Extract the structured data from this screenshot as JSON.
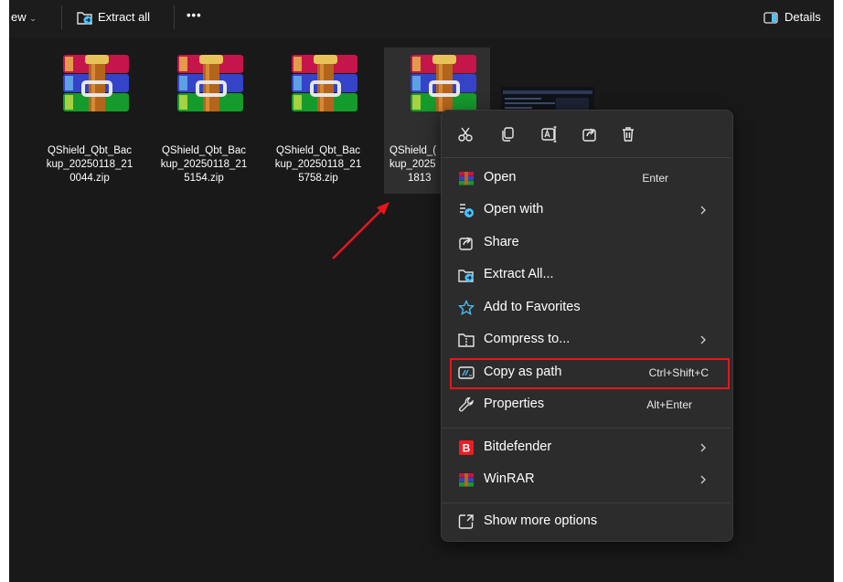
{
  "toolbar": {
    "view_fragment": "ew",
    "extract_all_label": "Extract all",
    "more_label": "•••",
    "details_label": "Details"
  },
  "files": [
    {
      "line1": "QShield_Qbt_Bac",
      "line2": "kup_20250118_21",
      "line3": "0044.zip"
    },
    {
      "line1": "QShield_Qbt_Bac",
      "line2": "kup_20250118_21",
      "line3": "5154.zip"
    },
    {
      "line1": "QShield_Qbt_Bac",
      "line2": "kup_20250118_21",
      "line3": "5758.zip"
    },
    {
      "line1": "QShield_(",
      "line2": "kup_2025",
      "line3": "1813"
    }
  ],
  "quick_actions": [
    "cut-icon",
    "copy-icon",
    "rename-icon",
    "share-icon",
    "delete-icon"
  ],
  "context_menu": {
    "items": [
      {
        "label": "Open",
        "shortcut": "Enter",
        "icon": "winrar-icon"
      },
      {
        "label": "Open with",
        "icon": "open-with-icon"
      },
      {
        "label": "Share",
        "icon": "share-icon"
      },
      {
        "label": "Extract All...",
        "icon": "extract-icon"
      },
      {
        "label": "Add to Favorites",
        "icon": "star-icon"
      },
      {
        "label": "Compress to...",
        "icon": "compress-icon"
      },
      {
        "label": "Copy as path",
        "shortcut": "Ctrl+Shift+C",
        "icon": "copy-path-icon"
      },
      {
        "label": "Properties",
        "shortcut": "Alt+Enter",
        "icon": "wrench-icon"
      },
      {
        "label": "Bitdefender",
        "icon": "bitdefender-icon"
      },
      {
        "label": "WinRAR",
        "icon": "winrar-icon"
      },
      {
        "label": "Show more options",
        "icon": "show-more-icon"
      }
    ]
  },
  "colors": {
    "window_bg": "#191919",
    "menu_bg": "#2c2c2c",
    "highlight": "#e8151b",
    "accent": "#4cc2ff"
  }
}
